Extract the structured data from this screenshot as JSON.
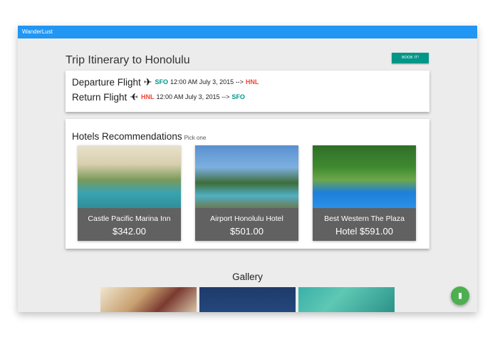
{
  "app": {
    "title": "WanderLust"
  },
  "trip": {
    "title": "Trip Itinerary to Honolulu",
    "book_label": "BOOK IT!"
  },
  "flights": {
    "departure": {
      "label": "Departure Flight",
      "from": "SFO",
      "text": "12:00 AM July 3, 2015 -->",
      "to": "HNL"
    },
    "return": {
      "label": "Return Flight",
      "from": "HNL",
      "text": "12:00 AM July 3, 2015 -->",
      "to": "SFO"
    }
  },
  "hotels": {
    "title": "Hotels Recommendations",
    "subtitle": "Pick one",
    "items": [
      {
        "name": "Castle Pacific Marina Inn",
        "price": "$342.00"
      },
      {
        "name": "Airport Honolulu Hotel",
        "price": "$501.00"
      },
      {
        "name": "Best Western The Plaza",
        "price": "Hotel $591.00"
      }
    ]
  },
  "gallery": {
    "title": "Gallery"
  },
  "colors": {
    "appbar": "#2196f3",
    "accent": "#009688",
    "red": "#f44336",
    "fab": "#4caf50"
  },
  "icons": {
    "plane": "airplane-icon",
    "fab": "book-icon"
  }
}
